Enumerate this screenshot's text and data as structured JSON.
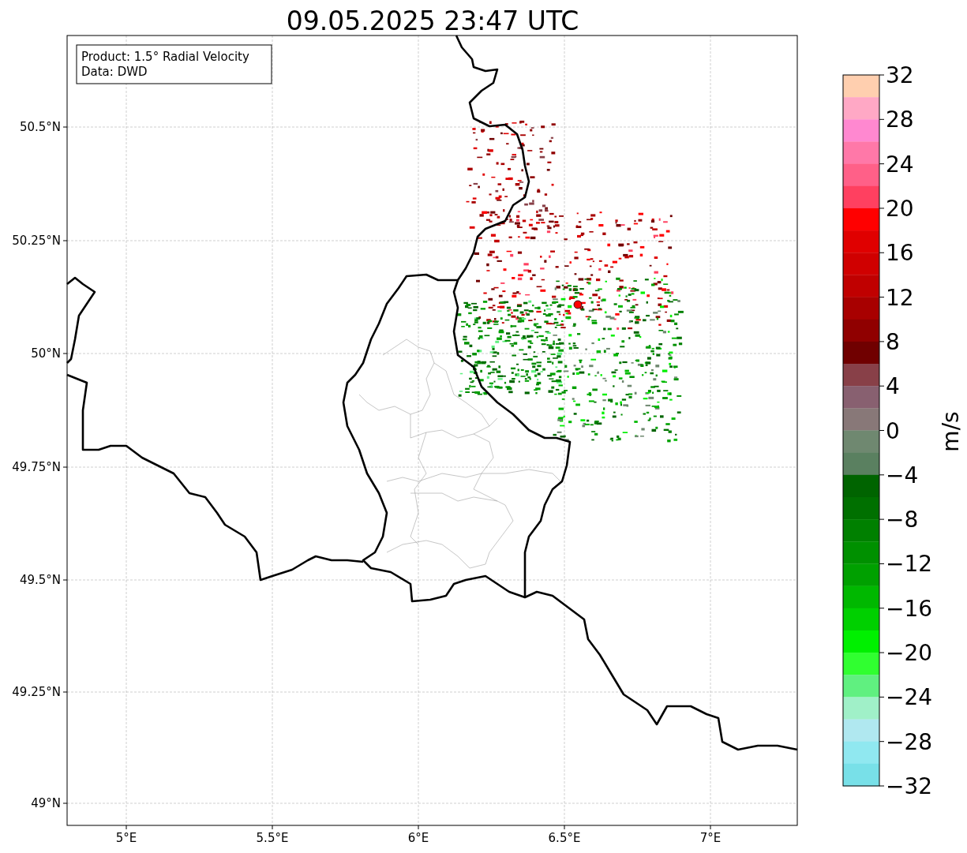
{
  "title": "09.05.2025 23:47 UTC",
  "info_box": {
    "lines": [
      "Product: 1.5° Radial Velocity",
      "Data: DWD"
    ]
  },
  "map": {
    "x_tick_labels": [
      "5°E",
      "5.5°E",
      "6°E",
      "6.5°E",
      "7°E"
    ],
    "y_tick_labels": [
      "50.5°N",
      "50.25°N",
      "50°N",
      "49.75°N",
      "49.5°N",
      "49.25°N",
      "49°N"
    ]
  },
  "colorbar": {
    "label": "m/s",
    "tick_labels": [
      "32",
      "28",
      "24",
      "20",
      "16",
      "12",
      "8",
      "4",
      "0",
      "−4",
      "−8",
      "−12",
      "−16",
      "−20",
      "−24",
      "−28",
      "−32"
    ],
    "segments": [
      {
        "color": "#ffcfaf"
      },
      {
        "color": "#ffa8c5"
      },
      {
        "color": "#ff88d0"
      },
      {
        "color": "#ff78a8"
      },
      {
        "color": "#ff6088"
      },
      {
        "color": "#ff4060"
      },
      {
        "color": "#ff0000"
      },
      {
        "color": "#e00000"
      },
      {
        "color": "#d00000"
      },
      {
        "color": "#c00000"
      },
      {
        "color": "#a80000"
      },
      {
        "color": "#900000"
      },
      {
        "color": "#700000"
      },
      {
        "color": "#884048"
      },
      {
        "color": "#886070"
      },
      {
        "color": "#887878"
      },
      {
        "color": "#6f8870"
      },
      {
        "color": "#5a8060"
      },
      {
        "color": "#006400"
      },
      {
        "color": "#007000"
      },
      {
        "color": "#008000"
      },
      {
        "color": "#009000"
      },
      {
        "color": "#00a000"
      },
      {
        "color": "#00b800"
      },
      {
        "color": "#00d000"
      },
      {
        "color": "#00f000"
      },
      {
        "color": "#30ff30"
      },
      {
        "color": "#60f080"
      },
      {
        "color": "#a0f0c8"
      },
      {
        "color": "#b0e8f0"
      },
      {
        "color": "#90e8f0"
      },
      {
        "color": "#78e0e8"
      }
    ]
  }
}
